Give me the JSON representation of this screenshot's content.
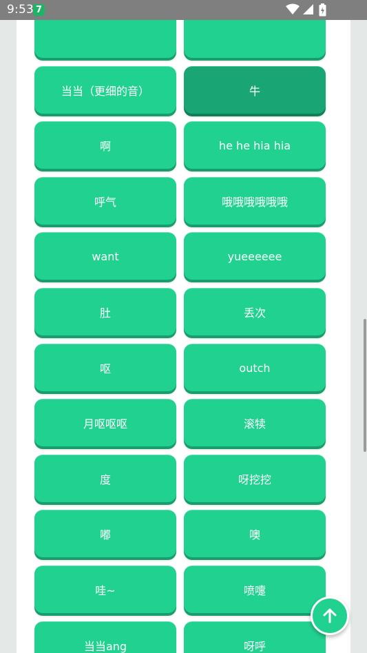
{
  "status_bar": {
    "time": "9:53",
    "app_badge": "7",
    "icons": [
      "wifi-icon",
      "signal-icon",
      "battery-icon"
    ]
  },
  "colors": {
    "button": "#21d18f",
    "button_active": "#1aa574",
    "status_bar": "#7f7f7f",
    "background": "#e4e9e7"
  },
  "buttons": [
    "",
    "",
    "当当（更细的音）",
    "牛",
    "啊",
    "he he hia hia",
    "呼气",
    "哦哦哦哦哦哦",
    "want",
    "yueeeeee",
    "肚",
    "丢次",
    "呕",
    "outch",
    "月呕呕呕",
    "滚犊",
    "度",
    "呀挖挖",
    "嘟",
    "噢",
    "哇~",
    "喷嚏",
    "当当ang",
    "呀呼"
  ],
  "fab": {
    "icon": "arrow-up-icon"
  }
}
